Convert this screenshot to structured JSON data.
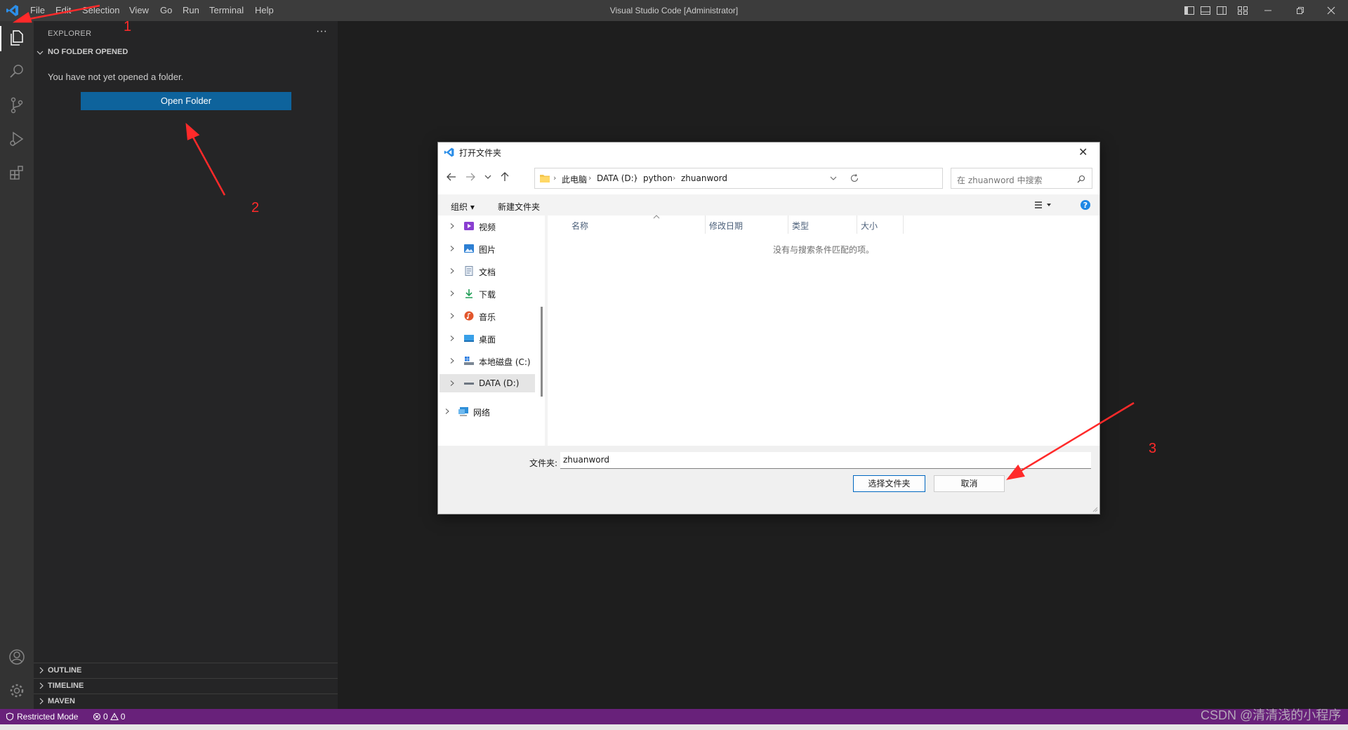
{
  "titlebar": {
    "menu": [
      "File",
      "Edit",
      "Selection",
      "View",
      "Go",
      "Run",
      "Terminal",
      "Help"
    ],
    "window_title": "Visual Studio Code [Administrator]"
  },
  "sidebar": {
    "title": "EXPLORER",
    "more": "···",
    "section": "NO FOLDER OPENED",
    "message": "You have not yet opened a folder.",
    "open_folder": "Open Folder",
    "bottom_sections": [
      "OUTLINE",
      "TIMELINE",
      "MAVEN"
    ]
  },
  "statusbar": {
    "restricted": "Restricted Mode",
    "errors": "0",
    "warnings": "0"
  },
  "dialog": {
    "title": "打开文件夹",
    "close": "✕",
    "breadcrumbs": [
      "此电脑",
      "DATA (D:)",
      "python",
      "zhuanword"
    ],
    "search_placeholder": "在 zhuanword 中搜索",
    "organize": "组织 ▾",
    "new_folder": "新建文件夹",
    "nav_items": [
      "视频",
      "图片",
      "文档",
      "下载",
      "音乐",
      "桌面",
      "本地磁盘 (C:)",
      "DATA (D:)",
      "网络"
    ],
    "columns": [
      "名称",
      "修改日期",
      "类型",
      "大小"
    ],
    "empty_message": "没有与搜索条件匹配的项。",
    "folder_label": "文件夹:",
    "folder_value": "zhuanword",
    "select_button": "选择文件夹",
    "cancel_button": "取消"
  },
  "annotations": [
    "1",
    "2",
    "3"
  ],
  "watermark": "CSDN @清清浅的小程序",
  "colors": {
    "accent": "#0e639c",
    "statusbar": "#68217a",
    "annotation": "#ff2a2a"
  }
}
